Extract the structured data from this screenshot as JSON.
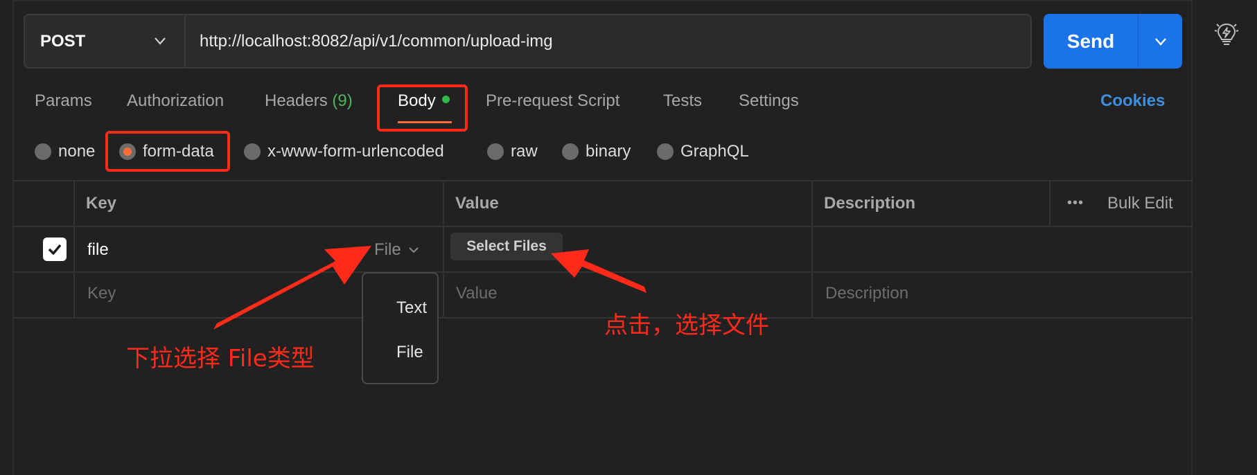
{
  "request": {
    "method": "POST",
    "url": "http://localhost:8082/api/v1/common/upload-img",
    "send_label": "Send"
  },
  "tabs": [
    {
      "label": "Params"
    },
    {
      "label": "Authorization"
    },
    {
      "label": "Headers",
      "count": "(9)"
    },
    {
      "label": "Body"
    },
    {
      "label": "Pre-request Script"
    },
    {
      "label": "Tests"
    },
    {
      "label": "Settings"
    }
  ],
  "cookies_label": "Cookies",
  "body_types": [
    {
      "label": "none"
    },
    {
      "label": "form-data",
      "selected": true
    },
    {
      "label": "x-www-form-urlencoded"
    },
    {
      "label": "raw"
    },
    {
      "label": "binary"
    },
    {
      "label": "GraphQL"
    }
  ],
  "table": {
    "headers": {
      "key": "Key",
      "value": "Value",
      "description": "Description"
    },
    "bulk_edit": "Bulk Edit",
    "more": "•••",
    "row": {
      "checked": true,
      "key": "file",
      "type": "File",
      "select_files": "Select Files"
    },
    "placeholders": {
      "key": "Key",
      "value": "Value",
      "description": "Description"
    }
  },
  "type_dropdown": {
    "options": [
      "Text",
      "File"
    ]
  },
  "annotations": {
    "left_note": "下拉选择 File类型",
    "right_note": "点击，选择文件",
    "color": "#ff2a1a"
  },
  "colors": {
    "accent": "#ff6c37",
    "send": "#1a74e8",
    "cookies": "#3d8fe0",
    "headers_count": "#4fb35d",
    "body_dot": "#2fba4a"
  }
}
